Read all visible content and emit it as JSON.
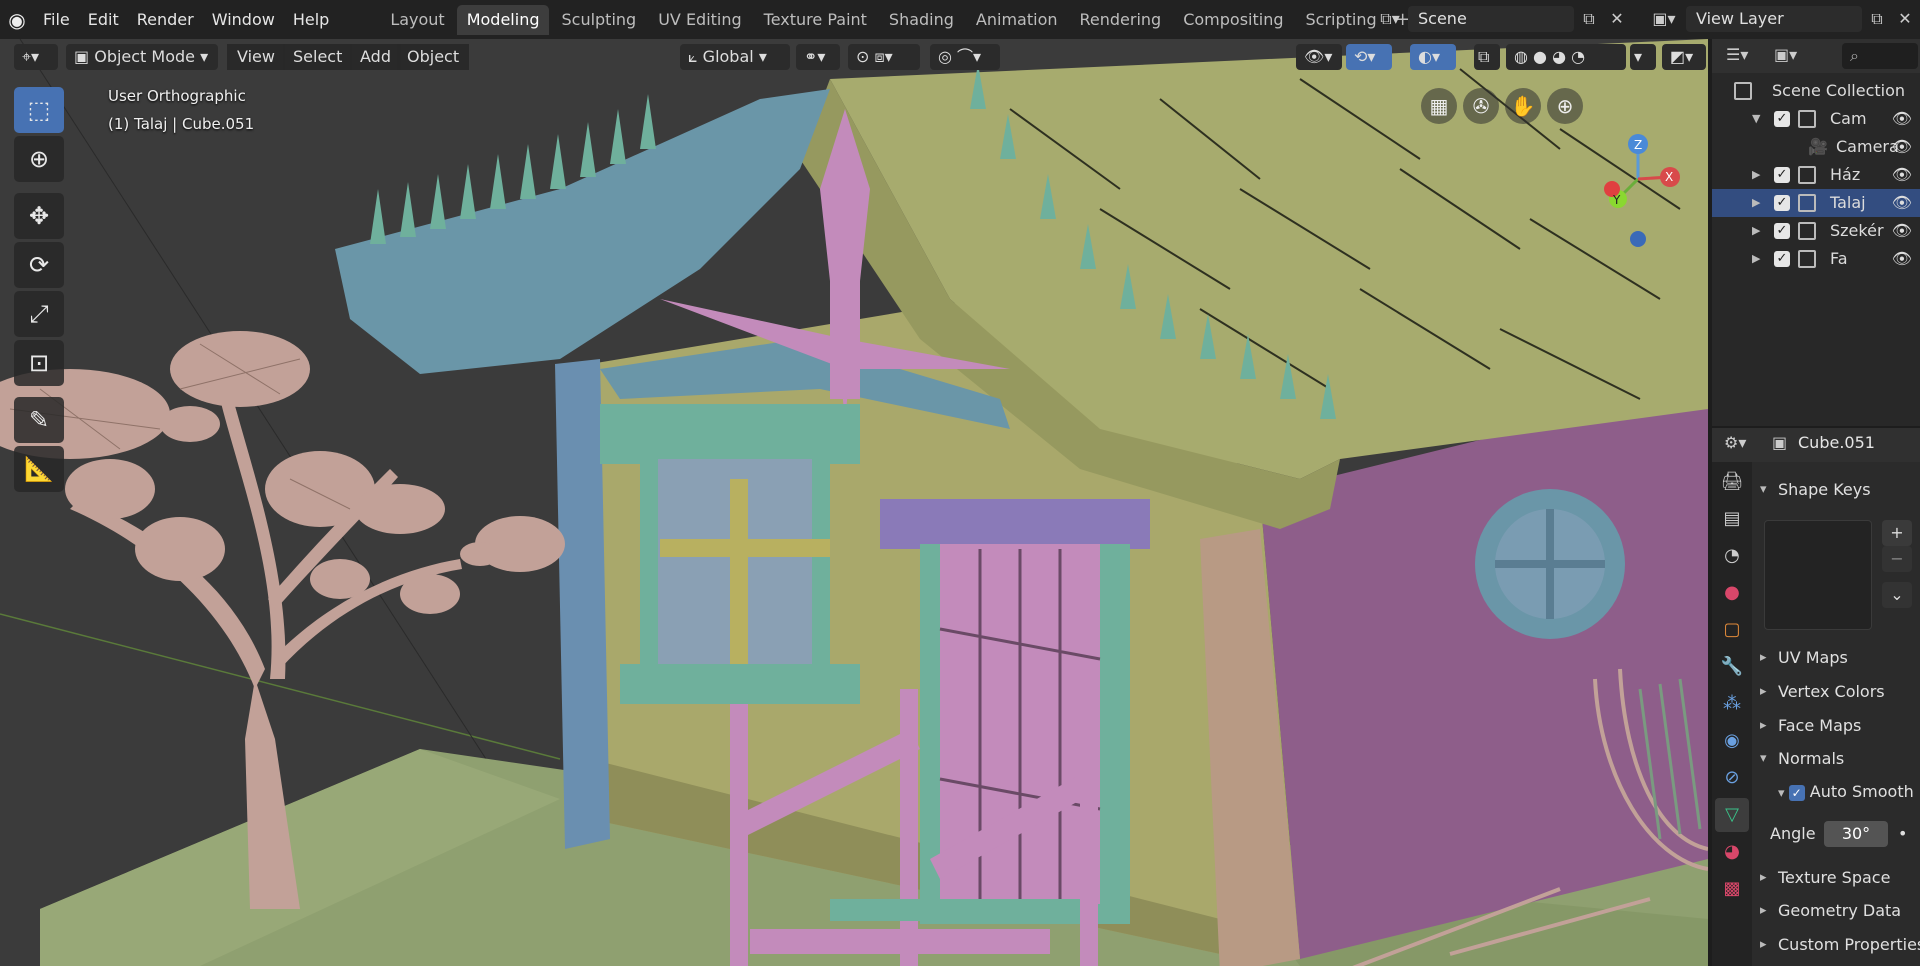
{
  "menu": [
    "File",
    "Edit",
    "Render",
    "Window",
    "Help"
  ],
  "workspaces": [
    "Layout",
    "Modeling",
    "Sculpting",
    "UV Editing",
    "Texture Paint",
    "Shading",
    "Animation",
    "Rendering",
    "Compositing",
    "Scripting"
  ],
  "active_workspace": "Modeling",
  "scene_name": "Scene",
  "view_layer": "View Layer",
  "viewport": {
    "mode": "Object Mode",
    "menus": [
      "View",
      "Select",
      "Add",
      "Object"
    ],
    "transform_orientation": "Global",
    "view_name": "User Orthographic",
    "active_info": "(1) Talaj | Cube.051"
  },
  "gizmo_axes": {
    "z": "Z",
    "y": "Y",
    "x": "X"
  },
  "outliner": {
    "root": "Scene Collection",
    "items": [
      {
        "label": "Cam",
        "expanded": true,
        "selected": false
      },
      {
        "label": "Camera",
        "expanded": false,
        "selected": false
      },
      {
        "label": "Ház",
        "expanded": false,
        "selected": false
      },
      {
        "label": "Talaj",
        "expanded": false,
        "selected": true
      },
      {
        "label": "Szekér",
        "expanded": false,
        "selected": false
      },
      {
        "label": "Fa",
        "expanded": false,
        "selected": false
      }
    ]
  },
  "properties": {
    "object_name": "Cube.051",
    "panels": {
      "shape_keys": "Shape Keys",
      "uv_maps": "UV Maps",
      "vertex_colors": "Vertex Colors",
      "face_maps": "Face Maps",
      "normals": "Normals",
      "auto_smooth": "Auto Smooth",
      "angle_label": "Angle",
      "angle_value": "30°",
      "texture_space": "Texture Space",
      "geometry_data": "Geometry Data",
      "custom_properties": "Custom Properties"
    }
  },
  "colors": {
    "accent": "#4772b3",
    "wall": "#a9a86b",
    "roof": "#a7ab6e",
    "trim_blue": "#6a96a8",
    "pink": "#c38bbb",
    "purple_wall": "#8e5e8a",
    "tree": "#c2a198",
    "ground": "#8fa070"
  }
}
